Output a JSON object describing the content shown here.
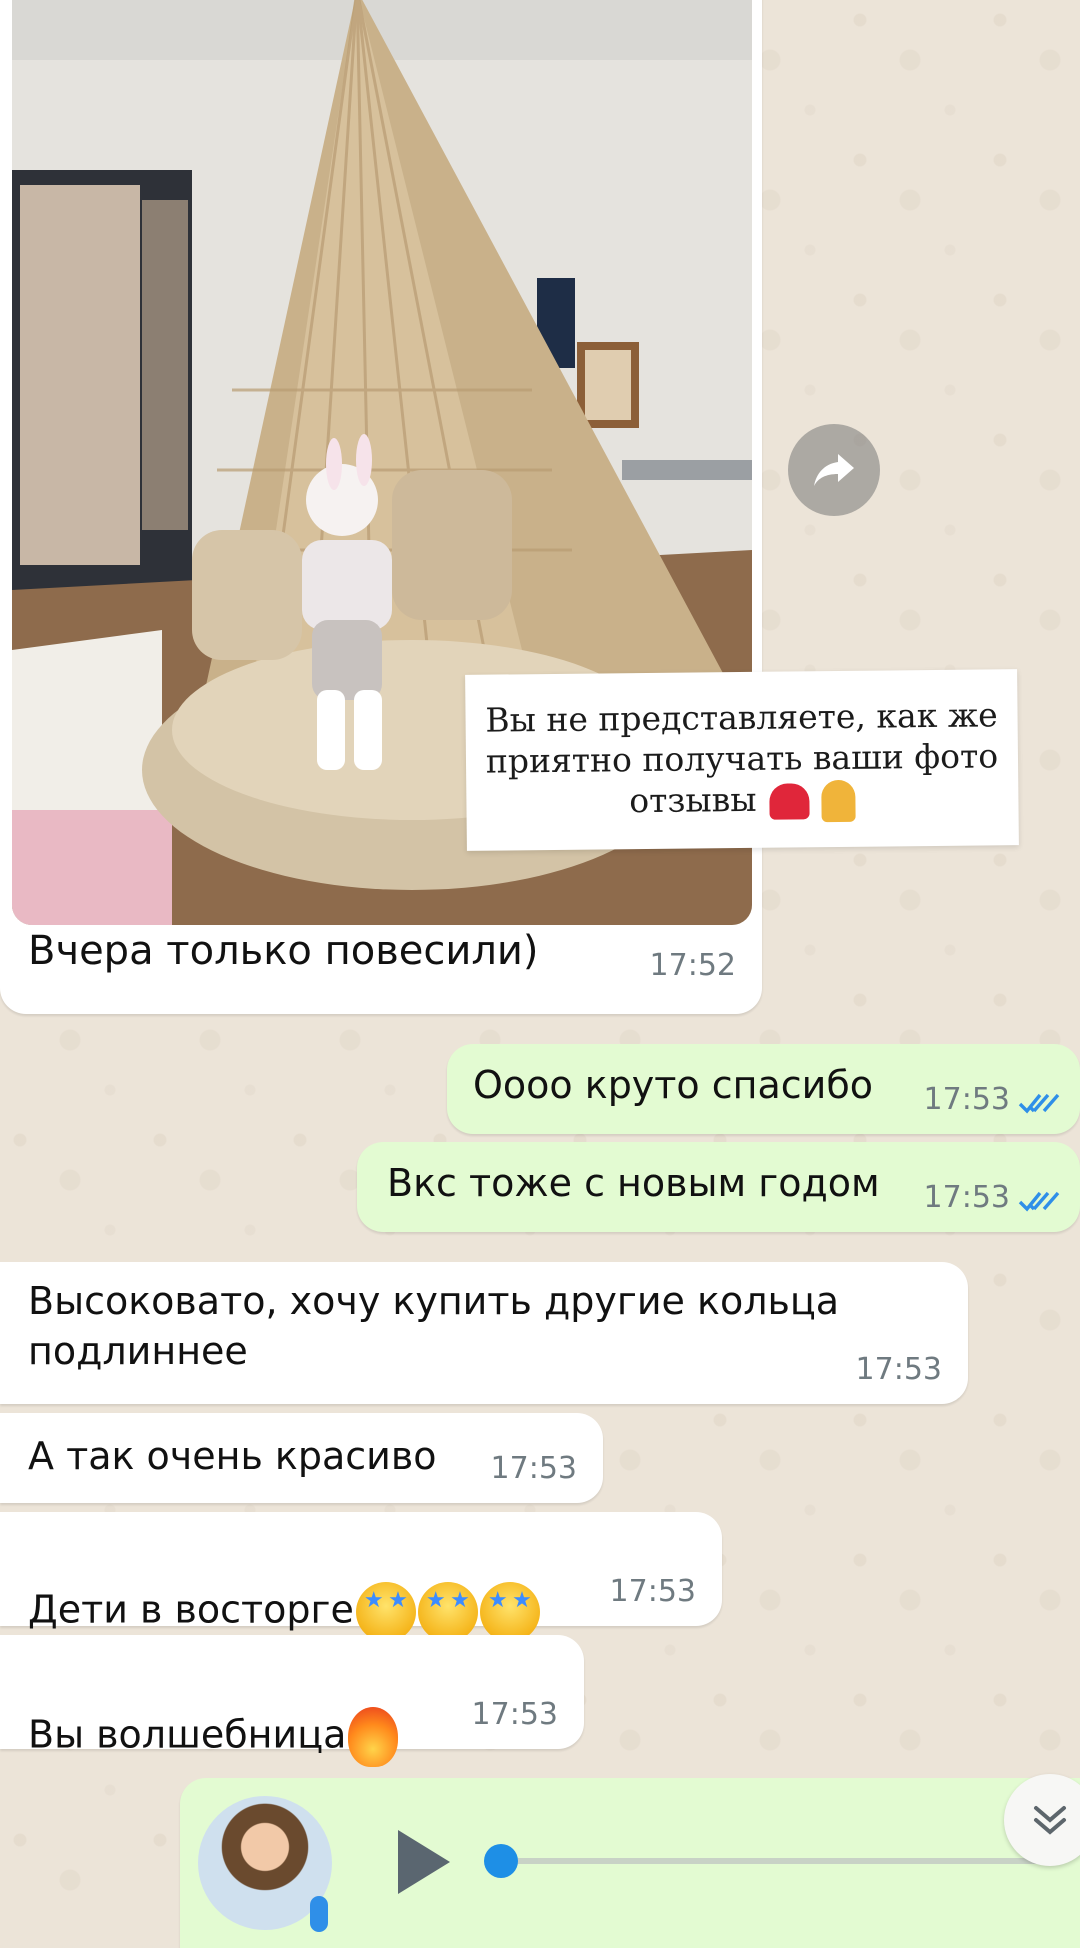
{
  "photo_message": {
    "overlay_text": "Вы не представляете, как же приятно получать ваши фото отзывы",
    "caption": "Вчера только повесили)",
    "time": "17:52"
  },
  "messages": [
    {
      "direction": "out",
      "text": "Оооо круто спасибо",
      "time": "17:53",
      "status": "read"
    },
    {
      "direction": "out",
      "text": "Вкс тоже с новым годом",
      "time": "17:53",
      "status": "read"
    },
    {
      "direction": "in",
      "text": "Высоковато, хочу купить другие кольца\nподлиннее",
      "time": "17:53"
    },
    {
      "direction": "in",
      "text": "А так очень красиво",
      "time": "17:53"
    },
    {
      "direction": "in",
      "text": "Дети в восторге",
      "time": "17:53",
      "emojis": [
        "star-struck",
        "star-struck",
        "star-struck"
      ]
    },
    {
      "direction": "in",
      "text": "Вы волшебница",
      "time": "17:53",
      "emojis": [
        "fire"
      ]
    }
  ],
  "icons": {
    "forward": "forward-arrow-icon",
    "scroll_down": "double-chevron-down-icon",
    "play": "play-icon",
    "mic": "mic-icon",
    "read_ticks": "double-check-icon"
  },
  "colors": {
    "incoming_bubble": "#ffffff",
    "outgoing_bubble": "#e3fbd2",
    "chat_background": "#ece4d8",
    "read_ticks": "#2f8fe8",
    "time_text": "#6f7a80"
  }
}
